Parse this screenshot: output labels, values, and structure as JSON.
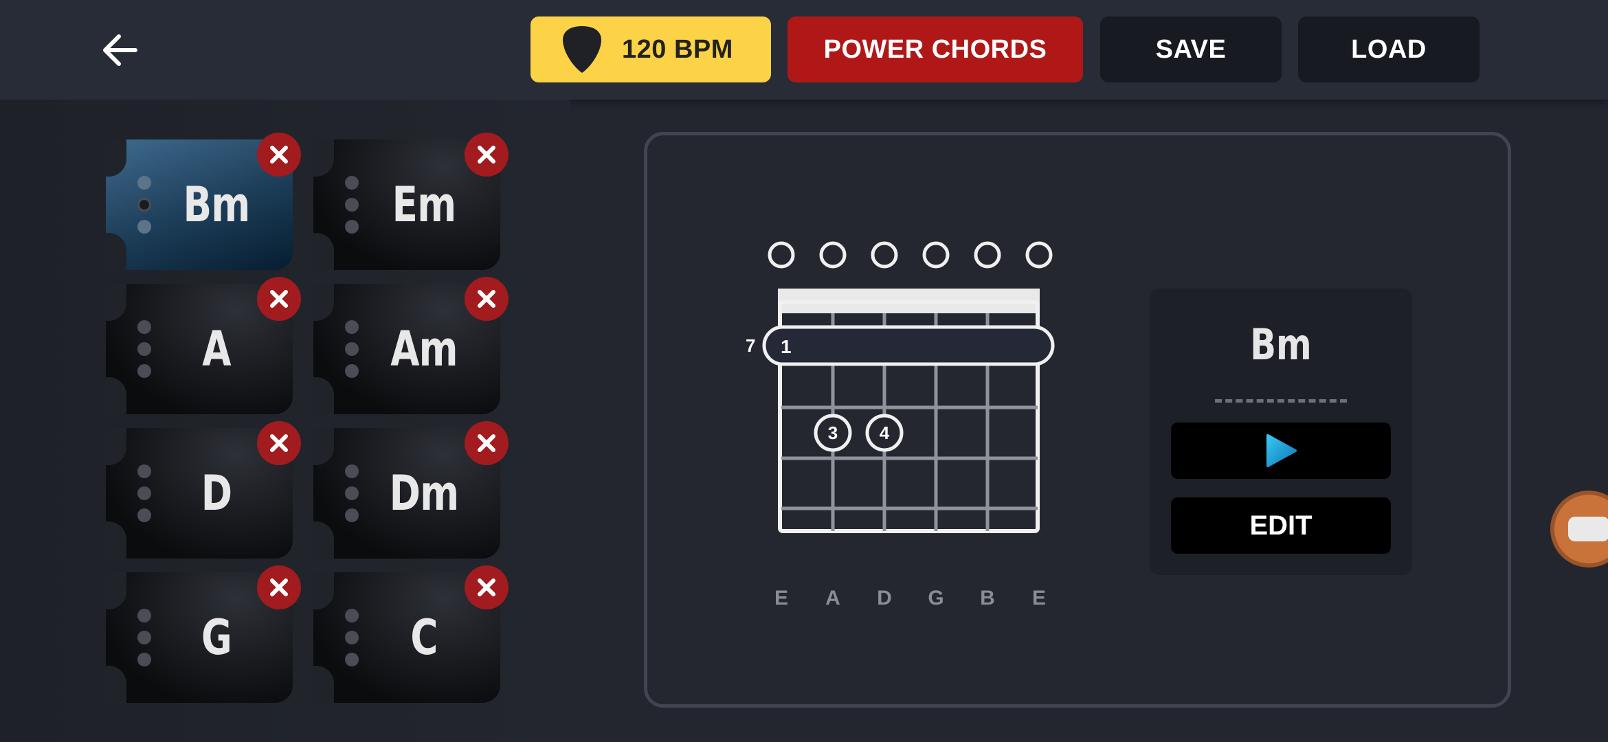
{
  "header": {
    "bpm_label": "120 BPM",
    "power_chords_label": "POWER CHORDS",
    "save_label": "SAVE",
    "load_label": "LOAD"
  },
  "colors": {
    "bpm": "#fcd246",
    "power": "#b01818",
    "active_tile": "#2a5478",
    "remove": "#a21b1e",
    "play": "#1aa3d9"
  },
  "icons": {
    "back": "arrow-left-icon",
    "bpm": "guitar-pick-icon",
    "remove": "close-icon",
    "play": "play-icon",
    "float": "camera-icon"
  },
  "chords": [
    {
      "name": "Bm",
      "active": true
    },
    {
      "name": "Em",
      "active": false
    },
    {
      "name": "A",
      "active": false
    },
    {
      "name": "Am",
      "active": false
    },
    {
      "name": "D",
      "active": false
    },
    {
      "name": "Dm",
      "active": false
    },
    {
      "name": "G",
      "active": false
    },
    {
      "name": "C",
      "active": false
    }
  ],
  "diagram": {
    "fret_number": "7",
    "barre_finger": "1",
    "strings": [
      "E",
      "A",
      "D",
      "G",
      "B",
      "E"
    ],
    "open_strings": [
      true,
      true,
      true,
      true,
      true,
      true
    ],
    "fingers": [
      {
        "string": 2,
        "fret": 2,
        "label": "3"
      },
      {
        "string": 3,
        "fret": 2,
        "label": "4"
      }
    ]
  },
  "info": {
    "title": "Bm",
    "edit_label": "EDIT"
  }
}
